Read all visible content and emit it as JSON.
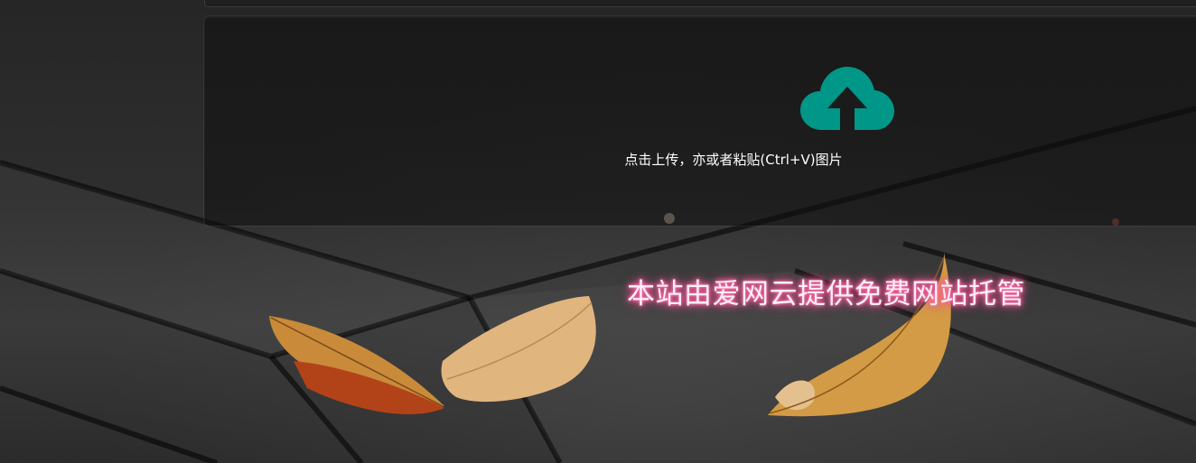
{
  "upload": {
    "icon": "cloud-upload-icon",
    "instruction": "点击上传，亦或者粘贴(Ctrl+V)图片",
    "icon_color": "#009688"
  },
  "footer": {
    "hosting_note": "本站由爱网云提供免费网站托管",
    "glow_color": "#ff5aa0"
  }
}
